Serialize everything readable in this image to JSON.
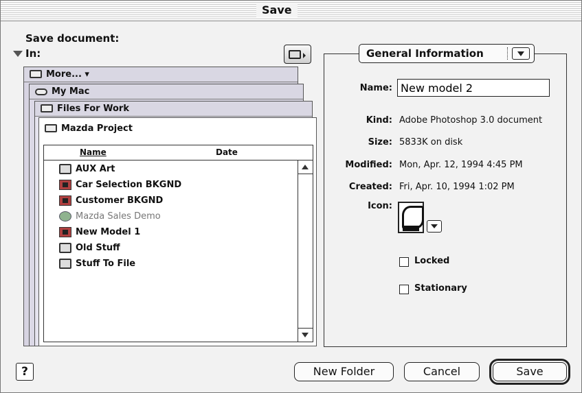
{
  "window": {
    "title": "Save"
  },
  "left": {
    "save_document_label": "Save document:",
    "in_label": "In:",
    "stack": [
      {
        "label": "More... ▾"
      },
      {
        "label": "My Mac"
      },
      {
        "label": "Files For Work"
      },
      {
        "label": "Mazda Project"
      }
    ],
    "list": {
      "headers": {
        "name": "Name",
        "date": "Date"
      },
      "items": [
        {
          "label": "AUX Art",
          "icon": "folder-icon"
        },
        {
          "label": "Car Selection BKGND",
          "icon": "document-icon"
        },
        {
          "label": "Customer BKGND",
          "icon": "document-icon"
        },
        {
          "label": "Mazda Sales Demo",
          "icon": "application-icon"
        },
        {
          "label": "New Model 1",
          "icon": "document-icon"
        },
        {
          "label": "Old Stuff",
          "icon": "folder-icon"
        },
        {
          "label": "Stuff To File",
          "icon": "folder-icon"
        }
      ]
    }
  },
  "right": {
    "group_selector": "General Information",
    "fields": {
      "name_label": "Name:",
      "name_value": "New model 2",
      "kind_label": "Kind:",
      "kind_value": "Adobe Photoshop 3.0 document",
      "size_label": "Size:",
      "size_value": "5833K on disk",
      "modified_label": "Modified:",
      "modified_value": "Mon, Apr. 12, 1994 4:45 PM",
      "created_label": "Created:",
      "created_value": "Fri, Apr. 10, 1994 1:02 PM",
      "icon_label": "Icon:"
    },
    "checkboxes": {
      "locked": "Locked",
      "stationary": "Stationary"
    }
  },
  "buttons": {
    "help": "?",
    "new_folder": "New Folder",
    "cancel": "Cancel",
    "save": "Save"
  }
}
